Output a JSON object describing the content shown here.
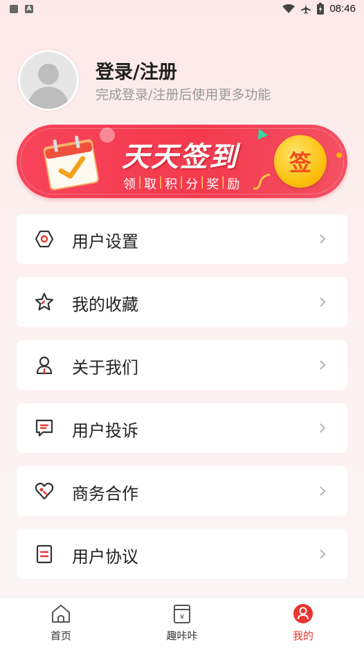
{
  "status_bar": {
    "time": "08:46",
    "left_icons": [
      "mail-icon",
      "font-a-icon"
    ],
    "right_icons": [
      "wifi-icon",
      "airplane-icon",
      "battery-icon"
    ]
  },
  "profile": {
    "title": "登录/注册",
    "subtitle": "完成登录/注册后使用更多功能"
  },
  "banner": {
    "title": "天天签到",
    "subtitle_chars": [
      "领",
      "取",
      "积",
      "分",
      "奖",
      "励"
    ],
    "sign_button": "签"
  },
  "menu": [
    {
      "label": "用户设置",
      "icon": "settings-hexagon-icon"
    },
    {
      "label": "我的收藏",
      "icon": "star-icon"
    },
    {
      "label": "关于我们",
      "icon": "person-icon"
    },
    {
      "label": "用户投诉",
      "icon": "message-icon"
    },
    {
      "label": "商务合作",
      "icon": "heart-handshake-icon"
    },
    {
      "label": "用户协议",
      "icon": "document-icon"
    }
  ],
  "tabs": [
    {
      "label": "首页",
      "icon": "home-icon",
      "active": false
    },
    {
      "label": "趣咔咔",
      "icon": "wallet-icon",
      "active": false
    },
    {
      "label": "我的",
      "icon": "profile-icon",
      "active": true
    }
  ],
  "colors": {
    "accent": "#e8362f",
    "banner_red": "#f4404f",
    "coin_yellow": "#fcc20f"
  }
}
